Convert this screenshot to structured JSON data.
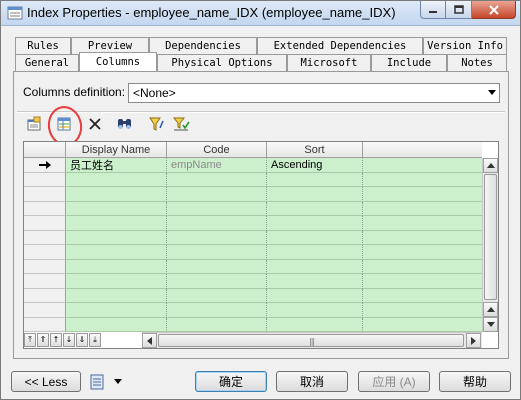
{
  "window": {
    "title": "Index Properties - employee_name_IDX (employee_name_IDX)",
    "controls": {
      "minimize": "minimize",
      "maximize": "maximize",
      "close": "close"
    }
  },
  "tabs": {
    "row_back": [
      "Rules",
      "Preview",
      "Dependencies",
      "Extended Dependencies",
      "Version Info"
    ],
    "row_front": [
      "General",
      "Columns",
      "Physical Options",
      "Microsoft",
      "Include",
      "Notes"
    ],
    "active": "Columns"
  },
  "columns_definition": {
    "label": "Columns definition:",
    "value": "<None>"
  },
  "toolbar": {
    "icons": [
      "properties-icon",
      "add-columns-icon",
      "delete-icon",
      "find-icon",
      "filter-icon",
      "customize-columns-icon"
    ]
  },
  "grid": {
    "headers": [
      "Display Name",
      "Code",
      "Sort"
    ],
    "rows": [
      {
        "display_name": "员工姓名",
        "code": "empName",
        "sort": "Ascending",
        "current": true
      }
    ],
    "empty_row_count": 11,
    "colors": {
      "row_bg": "#ccefcc"
    }
  },
  "bottom": {
    "less_label": "<< Less",
    "ok_label": "确定",
    "cancel_label": "取消",
    "apply_label": "应用 (A)",
    "help_label": "帮助"
  }
}
